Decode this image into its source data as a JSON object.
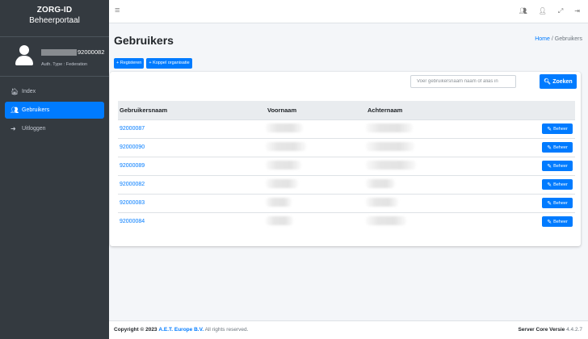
{
  "sidebar": {
    "brand_title": "ZORG-ID",
    "brand_subtitle": "Beheerportaal",
    "user_name_suffix": "92000082",
    "user_auth": "Auth. Type : Federation",
    "nav": [
      {
        "label": "Index",
        "icon": "home-icon",
        "active": false
      },
      {
        "label": "Gebruikers",
        "icon": "users-icon",
        "active": true
      },
      {
        "label": "Uitloggen",
        "icon": "sign-out-icon",
        "active": false
      }
    ]
  },
  "topbar": {
    "icons": [
      "users-icon",
      "user-icon",
      "fullscreen-icon",
      "logout-icon"
    ]
  },
  "header": {
    "title": "Gebruikers",
    "breadcrumb_home": "Home",
    "breadcrumb_separator": "/",
    "breadcrumb_current": "Gebruikers"
  },
  "actions": {
    "register_label": "+ Registeren",
    "link_org_label": "+ Koppel organisatie"
  },
  "search": {
    "placeholder": "Voer gebruikersnaam naam of alias in",
    "button_label": "Zoeken"
  },
  "table": {
    "headers": [
      "Gebruikersnaam",
      "Voornaam",
      "Achternaam",
      ""
    ],
    "rows": [
      {
        "username": "92000087",
        "action": "Beheer"
      },
      {
        "username": "92000090",
        "action": "Beheer"
      },
      {
        "username": "92000089",
        "action": "Beheer"
      },
      {
        "username": "92000082",
        "action": "Beheer"
      },
      {
        "username": "92000083",
        "action": "Beheer"
      },
      {
        "username": "92000084",
        "action": "Beheer"
      }
    ]
  },
  "footer": {
    "copyright_prefix": "Copyright © 2023",
    "company": "A.E.T. Europe B.V.",
    "rights": "All rights reserved.",
    "version_label": "Server Core Versie",
    "version_number": "4.4.2.7"
  },
  "colors": {
    "primary": "#007bff",
    "sidebar": "#343a40",
    "content_bg": "#f4f6f9"
  }
}
